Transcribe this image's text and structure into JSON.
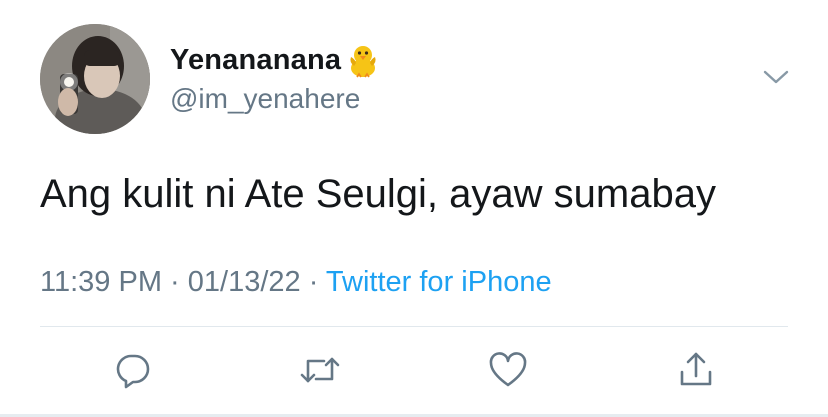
{
  "user": {
    "display_name": "Yenananana",
    "handle": "@im_yenahere",
    "name_emoji": "baby-chick-icon"
  },
  "tweet": {
    "text": "Ang kulit ni Ate Seulgi, ayaw sumabay",
    "time": "11:39 PM",
    "date": "01/13/22",
    "separator": "·",
    "source": "Twitter for iPhone"
  },
  "actions": [
    {
      "name": "reply",
      "icon": "reply-icon"
    },
    {
      "name": "retweet",
      "icon": "retweet-icon"
    },
    {
      "name": "like",
      "icon": "heart-icon"
    },
    {
      "name": "share",
      "icon": "share-icon"
    }
  ],
  "colors": {
    "text": "#14171a",
    "secondary": "#657786",
    "link": "#1da1f2",
    "divider": "#e1e8ed"
  }
}
